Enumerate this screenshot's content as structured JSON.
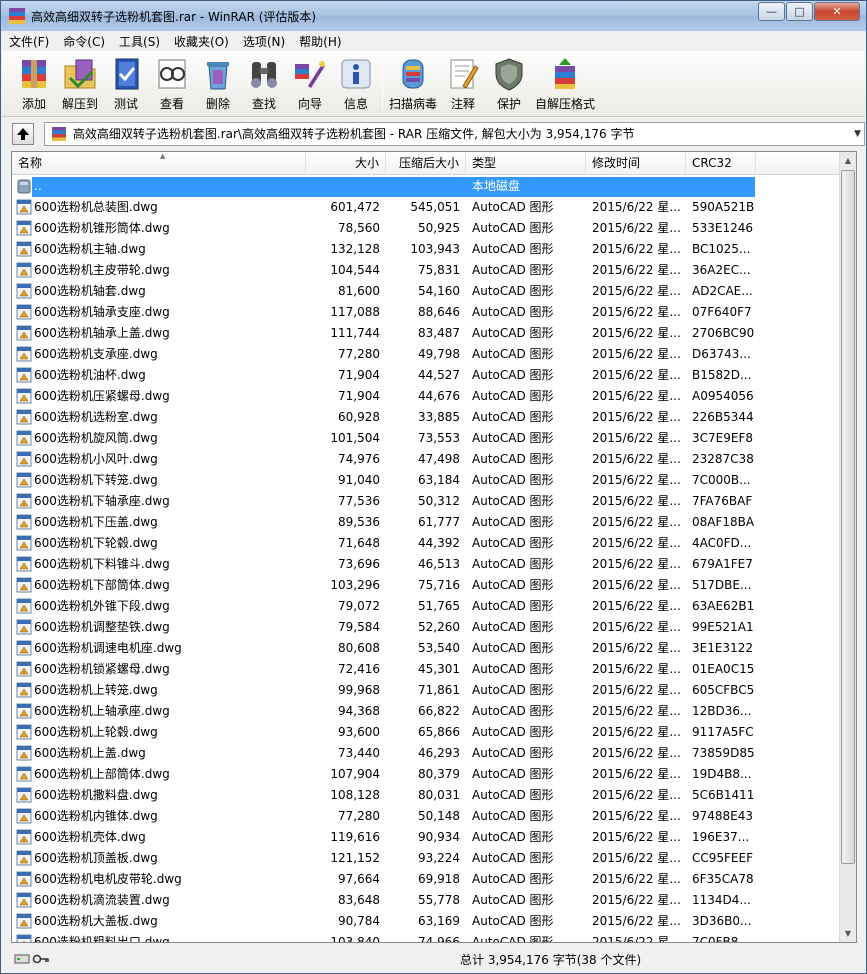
{
  "window": {
    "title": "高效高细双转子选粉机套图.rar - WinRAR (评估版本)",
    "controls": [
      "minimize",
      "maximize",
      "close"
    ]
  },
  "menu": [
    "文件(F)",
    "命令(C)",
    "工具(S)",
    "收藏夹(O)",
    "选项(N)",
    "帮助(H)"
  ],
  "toolbar": [
    {
      "label": "添加",
      "icon": "add-archive-icon"
    },
    {
      "label": "解压到",
      "icon": "extract-to-icon"
    },
    {
      "label": "测试",
      "icon": "test-icon"
    },
    {
      "label": "查看",
      "icon": "view-icon"
    },
    {
      "label": "删除",
      "icon": "delete-icon"
    },
    {
      "label": "查找",
      "icon": "find-icon"
    },
    {
      "label": "向导",
      "icon": "wizard-icon"
    },
    {
      "label": "信息",
      "icon": "info-icon"
    },
    {
      "label": "扫描病毒",
      "icon": "virus-scan-icon"
    },
    {
      "label": "注释",
      "icon": "comment-icon"
    },
    {
      "label": "保护",
      "icon": "protect-icon"
    },
    {
      "label": "自解压格式",
      "icon": "sfx-icon"
    }
  ],
  "address": {
    "path": "高效高细双转子选粉机套图.rar\\高效高细双转子选粉机套图 - RAR 压缩文件, 解包大小为 3,954,176 字节"
  },
  "columns": [
    "名称",
    "大小",
    "压缩后大小",
    "类型",
    "修改时间",
    "CRC32"
  ],
  "parent_row": {
    "name": "..",
    "type": "本地磁盘"
  },
  "files": [
    {
      "name": "600选粉机总装图.dwg",
      "size": "601,472",
      "packed": "545,051",
      "type": "AutoCAD 图形",
      "modified": "2015/6/22 星...",
      "crc": "590A521B"
    },
    {
      "name": "600选粉机锥形筒体.dwg",
      "size": "78,560",
      "packed": "50,925",
      "type": "AutoCAD 图形",
      "modified": "2015/6/22 星...",
      "crc": "533E1246"
    },
    {
      "name": "600选粉机主轴.dwg",
      "size": "132,128",
      "packed": "103,943",
      "type": "AutoCAD 图形",
      "modified": "2015/6/22 星...",
      "crc": "BC1025..."
    },
    {
      "name": "600选粉机主皮带轮.dwg",
      "size": "104,544",
      "packed": "75,831",
      "type": "AutoCAD 图形",
      "modified": "2015/6/22 星...",
      "crc": "36A2EC..."
    },
    {
      "name": "600选粉机轴套.dwg",
      "size": "81,600",
      "packed": "54,160",
      "type": "AutoCAD 图形",
      "modified": "2015/6/22 星...",
      "crc": "AD2CAE..."
    },
    {
      "name": "600选粉机轴承支座.dwg",
      "size": "117,088",
      "packed": "88,646",
      "type": "AutoCAD 图形",
      "modified": "2015/6/22 星...",
      "crc": "07F640F7"
    },
    {
      "name": "600选粉机轴承上盖.dwg",
      "size": "111,744",
      "packed": "83,487",
      "type": "AutoCAD 图形",
      "modified": "2015/6/22 星...",
      "crc": "2706BC90"
    },
    {
      "name": "600选粉机支承座.dwg",
      "size": "77,280",
      "packed": "49,798",
      "type": "AutoCAD 图形",
      "modified": "2015/6/22 星...",
      "crc": "D63743..."
    },
    {
      "name": "600选粉机油杯.dwg",
      "size": "71,904",
      "packed": "44,527",
      "type": "AutoCAD 图形",
      "modified": "2015/6/22 星...",
      "crc": "B1582D..."
    },
    {
      "name": "600选粉机压紧螺母.dwg",
      "size": "71,904",
      "packed": "44,676",
      "type": "AutoCAD 图形",
      "modified": "2015/6/22 星...",
      "crc": "A0954056"
    },
    {
      "name": "600选粉机选粉室.dwg",
      "size": "60,928",
      "packed": "33,885",
      "type": "AutoCAD 图形",
      "modified": "2015/6/22 星...",
      "crc": "226B5344"
    },
    {
      "name": "600选粉机旋风筒.dwg",
      "size": "101,504",
      "packed": "73,553",
      "type": "AutoCAD 图形",
      "modified": "2015/6/22 星...",
      "crc": "3C7E9EF8"
    },
    {
      "name": "600选粉机小风叶.dwg",
      "size": "74,976",
      "packed": "47,498",
      "type": "AutoCAD 图形",
      "modified": "2015/6/22 星...",
      "crc": "23287C38"
    },
    {
      "name": "600选粉机下转笼.dwg",
      "size": "91,040",
      "packed": "63,184",
      "type": "AutoCAD 图形",
      "modified": "2015/6/22 星...",
      "crc": "7C000B..."
    },
    {
      "name": "600选粉机下轴承座.dwg",
      "size": "77,536",
      "packed": "50,312",
      "type": "AutoCAD 图形",
      "modified": "2015/6/22 星...",
      "crc": "7FA76BAF"
    },
    {
      "name": "600选粉机下压盖.dwg",
      "size": "89,536",
      "packed": "61,777",
      "type": "AutoCAD 图形",
      "modified": "2015/6/22 星...",
      "crc": "08AF18BA"
    },
    {
      "name": "600选粉机下轮毂.dwg",
      "size": "71,648",
      "packed": "44,392",
      "type": "AutoCAD 图形",
      "modified": "2015/6/22 星...",
      "crc": "4AC0FD..."
    },
    {
      "name": "600选粉机下料锥斗.dwg",
      "size": "73,696",
      "packed": "46,513",
      "type": "AutoCAD 图形",
      "modified": "2015/6/22 星...",
      "crc": "679A1FE7"
    },
    {
      "name": "600选粉机下部筒体.dwg",
      "size": "103,296",
      "packed": "75,716",
      "type": "AutoCAD 图形",
      "modified": "2015/6/22 星...",
      "crc": "517DBE..."
    },
    {
      "name": "600选粉机外锥下段.dwg",
      "size": "79,072",
      "packed": "51,765",
      "type": "AutoCAD 图形",
      "modified": "2015/6/22 星...",
      "crc": "63AE62B1"
    },
    {
      "name": "600选粉机调整垫铁.dwg",
      "size": "79,584",
      "packed": "52,260",
      "type": "AutoCAD 图形",
      "modified": "2015/6/22 星...",
      "crc": "99E521A1"
    },
    {
      "name": "600选粉机调速电机座.dwg",
      "size": "80,608",
      "packed": "53,540",
      "type": "AutoCAD 图形",
      "modified": "2015/6/22 星...",
      "crc": "3E1E3122"
    },
    {
      "name": "600选粉机锁紧螺母.dwg",
      "size": "72,416",
      "packed": "45,301",
      "type": "AutoCAD 图形",
      "modified": "2015/6/22 星...",
      "crc": "01EA0C15"
    },
    {
      "name": "600选粉机上转笼.dwg",
      "size": "99,968",
      "packed": "71,861",
      "type": "AutoCAD 图形",
      "modified": "2015/6/22 星...",
      "crc": "605CFBC5"
    },
    {
      "name": "600选粉机上轴承座.dwg",
      "size": "94,368",
      "packed": "66,822",
      "type": "AutoCAD 图形",
      "modified": "2015/6/22 星...",
      "crc": "12BD36..."
    },
    {
      "name": "600选粉机上轮毂.dwg",
      "size": "93,600",
      "packed": "65,866",
      "type": "AutoCAD 图形",
      "modified": "2015/6/22 星...",
      "crc": "9117A5FC"
    },
    {
      "name": "600选粉机上盖.dwg",
      "size": "73,440",
      "packed": "46,293",
      "type": "AutoCAD 图形",
      "modified": "2015/6/22 星...",
      "crc": "73859D85"
    },
    {
      "name": "600选粉机上部筒体.dwg",
      "size": "107,904",
      "packed": "80,379",
      "type": "AutoCAD 图形",
      "modified": "2015/6/22 星...",
      "crc": "19D4B8..."
    },
    {
      "name": "600选粉机撒料盘.dwg",
      "size": "108,128",
      "packed": "80,031",
      "type": "AutoCAD 图形",
      "modified": "2015/6/22 星...",
      "crc": "5C6B1411"
    },
    {
      "name": "600选粉机内锥体.dwg",
      "size": "77,280",
      "packed": "50,148",
      "type": "AutoCAD 图形",
      "modified": "2015/6/22 星...",
      "crc": "97488E43"
    },
    {
      "name": "600选粉机壳体.dwg",
      "size": "119,616",
      "packed": "90,934",
      "type": "AutoCAD 图形",
      "modified": "2015/6/22 星...",
      "crc": "196E37..."
    },
    {
      "name": "600选粉机顶盖板.dwg",
      "size": "121,152",
      "packed": "93,224",
      "type": "AutoCAD 图形",
      "modified": "2015/6/22 星...",
      "crc": "CC95FEEF"
    },
    {
      "name": "600选粉机电机皮带轮.dwg",
      "size": "97,664",
      "packed": "69,918",
      "type": "AutoCAD 图形",
      "modified": "2015/6/22 星...",
      "crc": "6F35CA78"
    },
    {
      "name": "600选粉机滴流装置.dwg",
      "size": "83,648",
      "packed": "55,778",
      "type": "AutoCAD 图形",
      "modified": "2015/6/22 星...",
      "crc": "1134D4..."
    },
    {
      "name": "600选粉机大盖板.dwg",
      "size": "90,784",
      "packed": "63,169",
      "type": "AutoCAD 图形",
      "modified": "2015/6/22 星...",
      "crc": "3D36B0..."
    },
    {
      "name": "600选粉机粗料出口.dwg",
      "size": "103,840",
      "packed": "74,966",
      "type": "AutoCAD 图形",
      "modified": "2015/6/22 星...",
      "crc": "7C0FB8..."
    }
  ],
  "status": {
    "text": "总计 3,954,176 字节(38 个文件)"
  },
  "colors": {
    "selection": "#3399ff",
    "title_gradient": "#a9c4e4"
  }
}
